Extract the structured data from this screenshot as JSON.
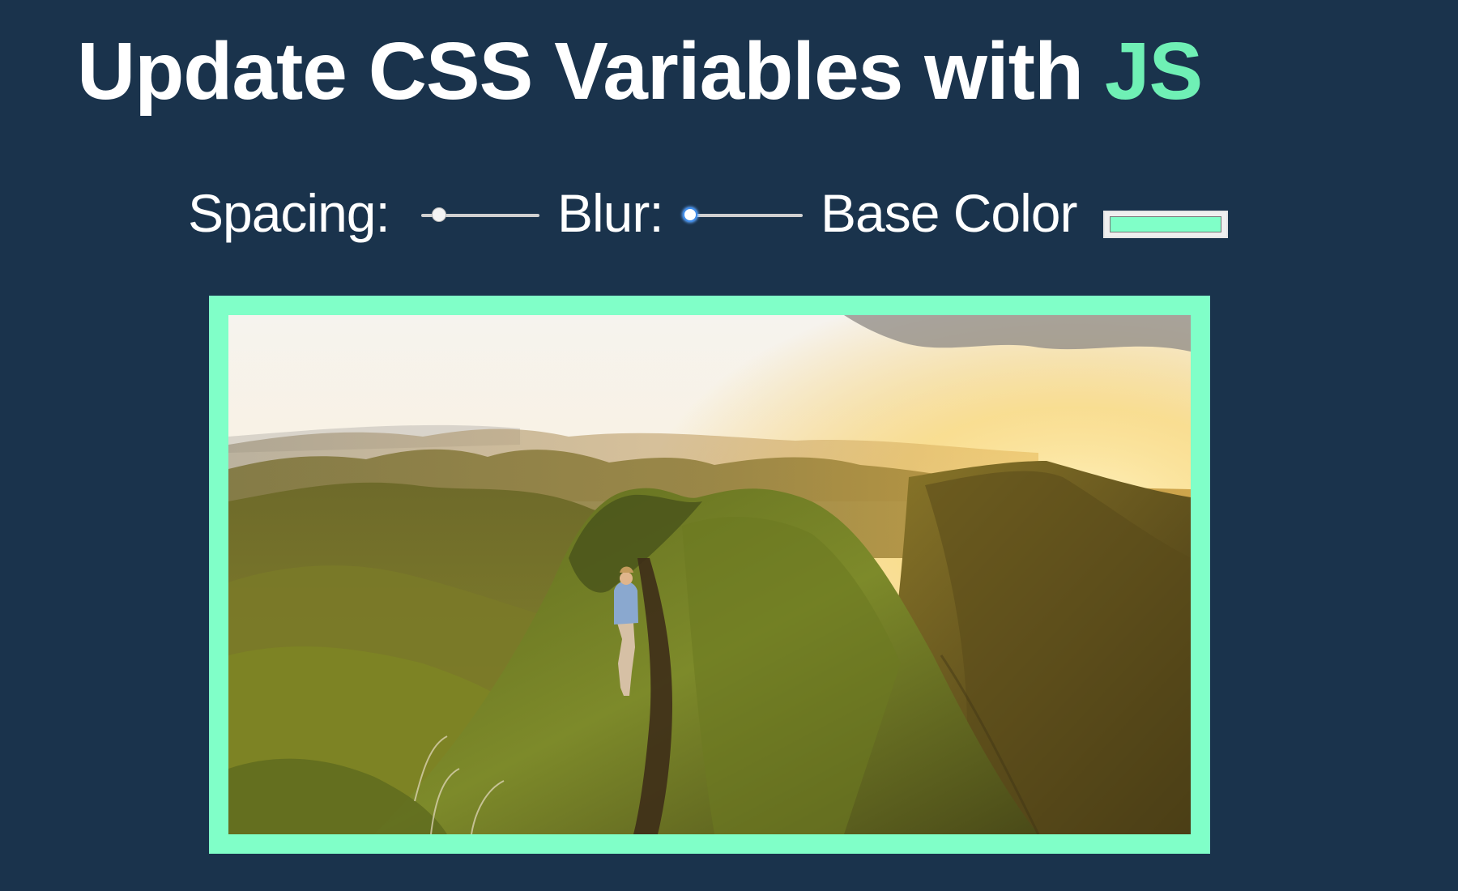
{
  "page": {
    "title_main": "Update CSS Variables with ",
    "title_highlight": "JS",
    "highlight_color": "#6ff0b5",
    "background_color": "#1a334c"
  },
  "controls": {
    "spacing": {
      "label": "Spacing:",
      "value_fraction": 0.1
    },
    "blur": {
      "label": "Blur:",
      "value_fraction": 0.0
    },
    "base_color": {
      "label": "Base Color",
      "value": "#80ffc8"
    }
  },
  "image": {
    "icon": "landscape-photo",
    "frame_color": "#80ffc8"
  }
}
